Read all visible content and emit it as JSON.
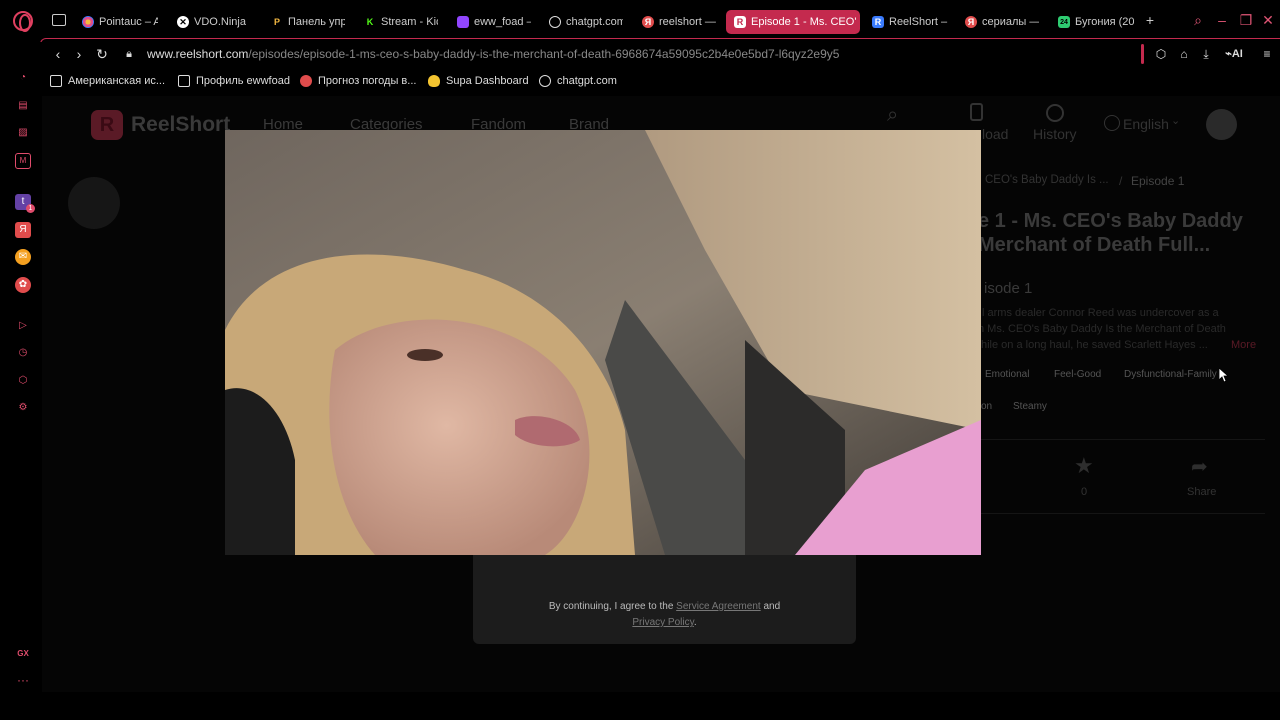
{
  "browser": {
    "tabs": [
      {
        "label": "Pointauc – A",
        "color": "#e04c8c"
      },
      {
        "label": "VDO.Ninja",
        "color": "#ffffff"
      },
      {
        "label": "Панель упр",
        "color": "#f4b942"
      },
      {
        "label": "Stream - Kic",
        "color": "#53fc18"
      },
      {
        "label": "eww_foad –",
        "color": "#9146ff"
      },
      {
        "label": "chatgpt.com",
        "color": "#dddddd"
      },
      {
        "label": "reelshort —",
        "color": "#e04c4c"
      },
      {
        "label": "Episode 1 - Ms. CEO'",
        "color": "#ffffff",
        "active": true
      },
      {
        "label": "ReelShort –",
        "color": "#3a7bfd"
      },
      {
        "label": "сериалы —",
        "color": "#e04c4c"
      },
      {
        "label": "Бугония (20",
        "color": "#2ecc71"
      }
    ],
    "url_host": "www.reelshort.com",
    "url_path": "/episodes/episode-1-ms-ceo-s-baby-daddy-is-the-merchant-of-death-6968674a59095c2b4e0e5bd7-l6qyz2e9y5",
    "ai_label": "AI",
    "bookmarks": [
      {
        "label": "Американская ис...",
        "color": "#dddddd"
      },
      {
        "label": "Профиль ewwfoad",
        "color": "#dddddd"
      },
      {
        "label": "Прогноз погоды в...",
        "color": "#e04c4c"
      },
      {
        "label": "Supa Dashboard",
        "color": "#f4c430"
      },
      {
        "label": "chatgpt.com",
        "color": "#dddddd"
      }
    ],
    "sidebar_gx": "GX",
    "sidebar_more": "···"
  },
  "site": {
    "logo_text": "ReelShort",
    "nav": {
      "home": "Home",
      "categories": "Categories",
      "fandom": "Fandom",
      "brand": "Brand"
    },
    "download": "load",
    "history": "History",
    "language": "English"
  },
  "episode": {
    "breadcrumb_series": "CEO's Baby Daddy Is ...",
    "breadcrumb_sep": "/",
    "breadcrumb_current": "Episode 1",
    "title_line1": "e 1 - Ms. CEO's Baby Daddy",
    "title_line2": "Merchant of Death Full...",
    "subtitle": "isode 1",
    "desc_line1": "l arms dealer Connor Reed was undercover as a",
    "desc_line2": "n Ms. CEO's Baby Daddy Is the Merchant of Death",
    "desc_line3": "hile on a long haul, he saved Scarlett Hayes ...",
    "more": "More",
    "tags_row1": [
      "Emotional",
      "Feel-Good",
      "Dysfunctional-Family"
    ],
    "tags_row2": [
      "on",
      "Steamy"
    ],
    "likes": "0",
    "share": "Share"
  },
  "modal": {
    "prefix": "By continuing, I agree to the ",
    "service": "Service Agreement",
    "and": " and",
    "privacy": "Privacy Policy",
    "suffix": "."
  }
}
